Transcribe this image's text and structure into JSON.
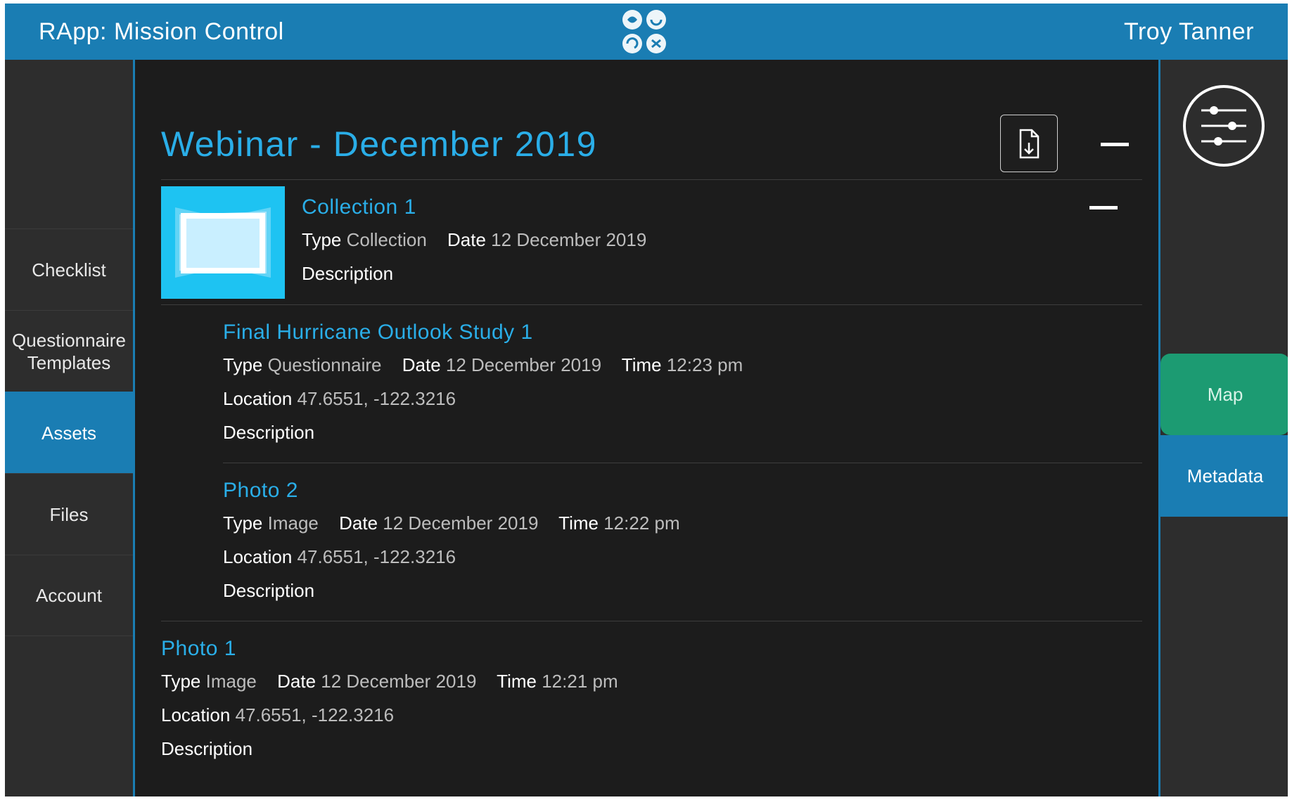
{
  "header": {
    "app_title": "RApp: Mission Control",
    "user_name": "Troy Tanner",
    "accent": "#1a7db3"
  },
  "sidebar": {
    "items": [
      {
        "label": "Checklist"
      },
      {
        "label": "Questionnaire Templates"
      },
      {
        "label": "Assets",
        "active": true
      },
      {
        "label": "Files"
      },
      {
        "label": "Account"
      }
    ]
  },
  "right_panel": {
    "filter_icon": "sliders-icon",
    "map_label": "Map",
    "metadata_label": "Metadata",
    "map_color": "#1c9b72"
  },
  "main": {
    "title": "Webinar - December 2019",
    "export_icon": "file-download-icon",
    "collection": {
      "title": "Collection 1",
      "type_key": "Type",
      "type": "Collection",
      "date_key": "Date",
      "date": "12 December 2019",
      "description_key": "Description",
      "thumbnail_icon": "image-stack-icon"
    },
    "children": [
      {
        "title": "Final Hurricane Outlook Study 1",
        "type_key": "Type",
        "type": "Questionnaire",
        "date_key": "Date",
        "date": "12 December 2019",
        "time_key": "Time",
        "time": "12:23 pm",
        "location_key": "Location",
        "location": "47.6551, -122.3216",
        "description_key": "Description"
      },
      {
        "title": "Photo 2",
        "type_key": "Type",
        "type": "Image",
        "date_key": "Date",
        "date": "12 December 2019",
        "time_key": "Time",
        "time": "12:22 pm",
        "location_key": "Location",
        "location": "47.6551, -122.3216",
        "description_key": "Description"
      }
    ],
    "top_level": [
      {
        "title": "Photo 1",
        "type_key": "Type",
        "type": "Image",
        "date_key": "Date",
        "date": "12 December 2019",
        "time_key": "Time",
        "time": "12:21 pm",
        "location_key": "Location",
        "location": "47.6551, -122.3216",
        "description_key": "Description"
      }
    ]
  }
}
